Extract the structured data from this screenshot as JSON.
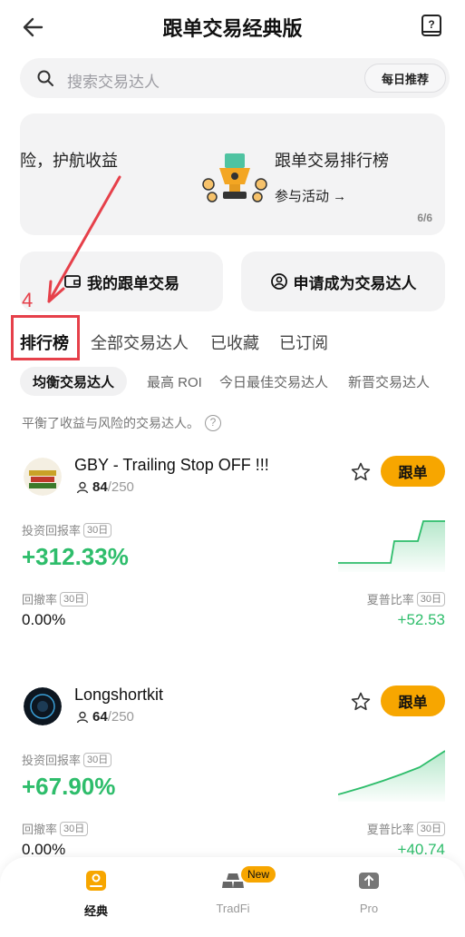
{
  "header": {
    "title": "跟单交易经典版"
  },
  "search": {
    "placeholder": "搜索交易达人",
    "daily_button": "每日推荐"
  },
  "banner": {
    "left_text": "险，护航收益",
    "title": "跟单交易排行榜",
    "link": "参与活动 →",
    "counter": "6/6"
  },
  "quick_actions": {
    "my_copy": "我的跟单交易",
    "apply": "申请成为交易达人"
  },
  "annotation": {
    "number": "4"
  },
  "tabs": [
    {
      "label": "排行榜",
      "active": true
    },
    {
      "label": "全部交易达人",
      "active": false
    },
    {
      "label": "已收藏",
      "active": false
    },
    {
      "label": "已订阅",
      "active": false
    }
  ],
  "chips": [
    {
      "label": "均衡交易达人",
      "active": true
    },
    {
      "label": "最高 ROI",
      "active": false
    },
    {
      "label": "今日最佳交易达人",
      "active": false
    },
    {
      "label": "新晋交易达人",
      "active": false
    }
  ],
  "description": "平衡了收益与风险的交易达人。",
  "traders": [
    {
      "name": "GBY - Trailing Stop OFF !!!",
      "followers": "84",
      "max_followers": "/250",
      "follow_label": "跟单",
      "roi_label": "投资回报率",
      "period": "30日",
      "roi": "+312.33%",
      "drawdown_label": "回撤率",
      "drawdown": "0.00%",
      "sharpe_label": "夏普比率",
      "sharpe": "+52.53"
    },
    {
      "name": "Longshortkit",
      "followers": "64",
      "max_followers": "/250",
      "follow_label": "跟单",
      "roi_label": "投资回报率",
      "period": "30日",
      "roi": "+67.90%",
      "drawdown_label": "回撤率",
      "drawdown": "0.00%",
      "sharpe_label": "夏普比率",
      "sharpe": "+40.74"
    }
  ],
  "bottom_nav": {
    "classic": "经典",
    "tradfi": "TradFi",
    "pro": "Pro",
    "new_badge": "New"
  },
  "colors": {
    "accent": "#f7a600",
    "positive": "#2ebd6b",
    "annotation": "#e6404a"
  }
}
